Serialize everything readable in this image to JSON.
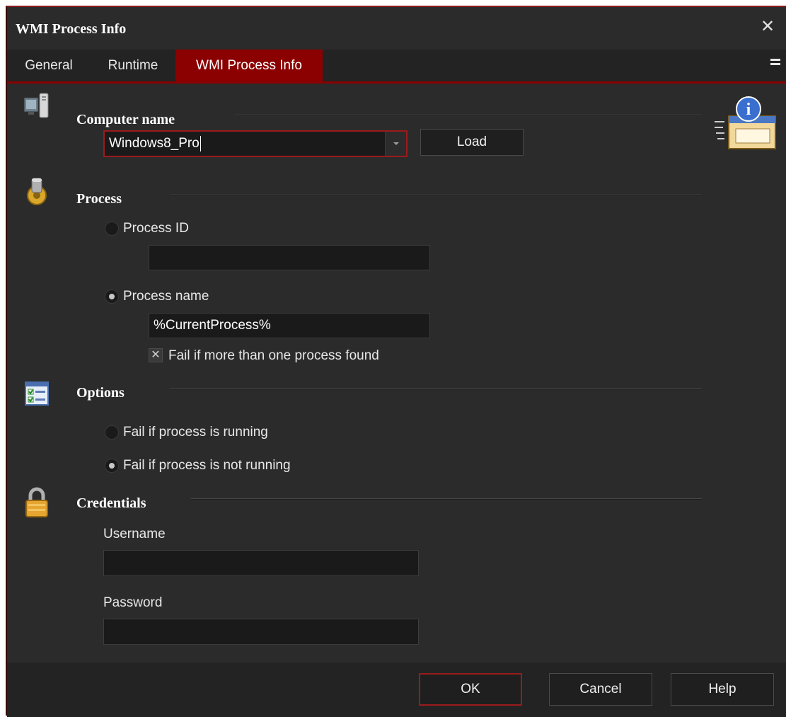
{
  "window": {
    "title": "WMI Process Info"
  },
  "tabs": [
    {
      "label": "General"
    },
    {
      "label": "Runtime"
    },
    {
      "label": "WMI Process Info",
      "active": true
    }
  ],
  "computer": {
    "section_title": "Computer name",
    "value": "Windows8_Pro",
    "load_label": "Load"
  },
  "process": {
    "section_title": "Process",
    "process_id_label": "Process ID",
    "process_id_value": "",
    "process_name_label": "Process name",
    "process_name_value": "%CurrentProcess%",
    "selected": "process_name",
    "fail_multiple_label": "Fail if more than one process found",
    "fail_multiple_checked": true
  },
  "options": {
    "section_title": "Options",
    "running_label": "Fail if process is running",
    "not_running_label": "Fail if process is not running",
    "selected": "not_running"
  },
  "credentials": {
    "section_title": "Credentials",
    "username_label": "Username",
    "username_value": "",
    "password_label": "Password",
    "password_value": ""
  },
  "footer": {
    "ok_label": "OK",
    "cancel_label": "Cancel",
    "help_label": "Help"
  },
  "colors": {
    "accent": "#8b0000",
    "background": "#2b2b2b",
    "field": "#1a1a1a"
  }
}
